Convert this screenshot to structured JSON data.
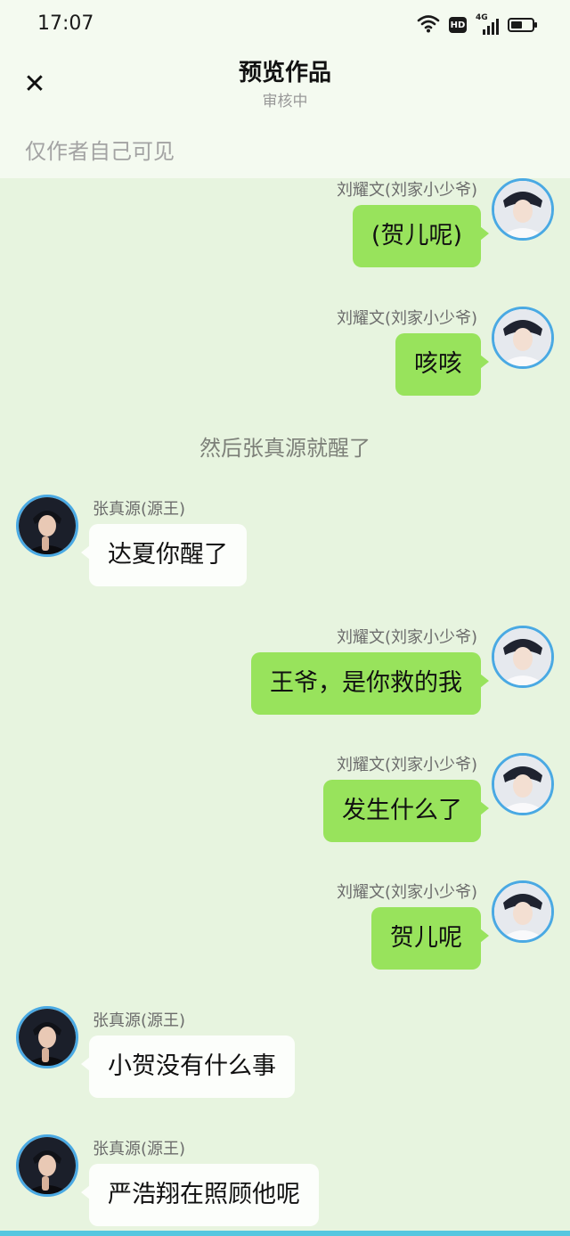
{
  "status_bar": {
    "time": "17:07",
    "network_badge": "HD",
    "signal_label": "4G",
    "icons": [
      "wifi-icon",
      "hd-icon",
      "signal-icon",
      "battery-icon"
    ]
  },
  "header": {
    "close_icon": "close-icon",
    "close_glyph": "✕",
    "title": "预览作品",
    "subtitle": "审核中",
    "visibility_note": "仅作者自己可见"
  },
  "messages": [
    {
      "side": "right",
      "sender": "刘耀文(刘家小少爷)",
      "text": "(贺儿呢)"
    },
    {
      "side": "right",
      "sender": "刘耀文(刘家小少爷)",
      "text": "咳咳"
    },
    {
      "type": "narration",
      "text": "然后张真源就醒了"
    },
    {
      "side": "left",
      "sender": "张真源(源王)",
      "text": "达夏你醒了"
    },
    {
      "side": "right",
      "sender": "刘耀文(刘家小少爷)",
      "text": "王爷，是你救的我"
    },
    {
      "side": "right",
      "sender": "刘耀文(刘家小少爷)",
      "text": "发生什么了"
    },
    {
      "side": "right",
      "sender": "刘耀文(刘家小少爷)",
      "text": "贺儿呢"
    },
    {
      "side": "left",
      "sender": "张真源(源王)",
      "text": "小贺没有什么事"
    },
    {
      "side": "left",
      "sender": "张真源(源王)",
      "text": "严浩翔在照顾他呢"
    }
  ],
  "colors": {
    "background": "#e7f4df",
    "header_background": "#f4faf0",
    "self_bubble": "#98e35c",
    "other_bubble": "#fcfefb",
    "avatar_ring": "#4aa9e3",
    "bottom_bar": "#55c7e0"
  }
}
